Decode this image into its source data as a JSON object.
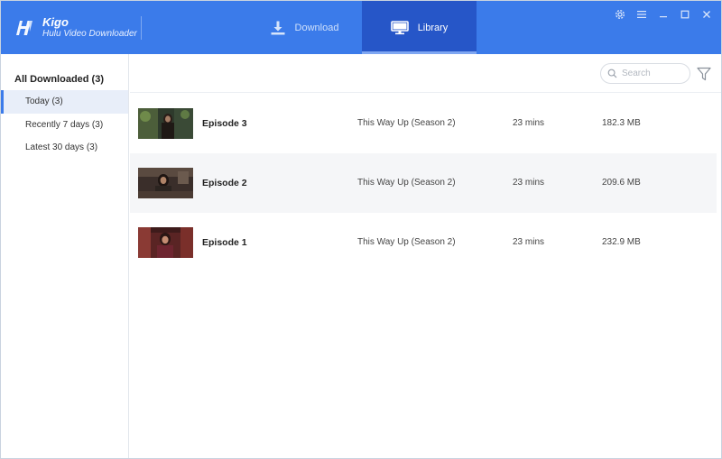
{
  "app": {
    "name": "Kigo",
    "subtitle": "Hulu Video Downloader"
  },
  "tabs": {
    "download": "Download",
    "library": "Library",
    "active": "library"
  },
  "icons": {
    "logo": "kigo-logo-icon",
    "download": "download-icon",
    "library": "monitor-icon",
    "settings": "gear-icon",
    "menu": "menu-icon",
    "minimize": "minimize-icon",
    "maximize": "maximize-icon",
    "close": "close-icon",
    "search": "search-icon",
    "filter": "filter-icon"
  },
  "colors": {
    "header": "#3b7bea",
    "active_tab": "#2656c8",
    "selected_sidebar": "#e8eef9"
  },
  "sidebar": {
    "heading": "All Downloaded (3)",
    "items": [
      {
        "label": "Today (3)",
        "active": true
      },
      {
        "label": "Recently 7 days (3)",
        "active": false
      },
      {
        "label": "Latest 30 days (3)",
        "active": false
      }
    ]
  },
  "search": {
    "placeholder": "Search",
    "value": ""
  },
  "videos": [
    {
      "title": "Episode 3",
      "series": "This Way Up (Season 2)",
      "duration": "23 mins",
      "size": "182.3 MB"
    },
    {
      "title": "Episode 2",
      "series": "This Way Up (Season 2)",
      "duration": "23 mins",
      "size": "209.6 MB"
    },
    {
      "title": "Episode 1",
      "series": "This Way Up (Season 2)",
      "duration": "23 mins",
      "size": "232.9 MB"
    }
  ]
}
